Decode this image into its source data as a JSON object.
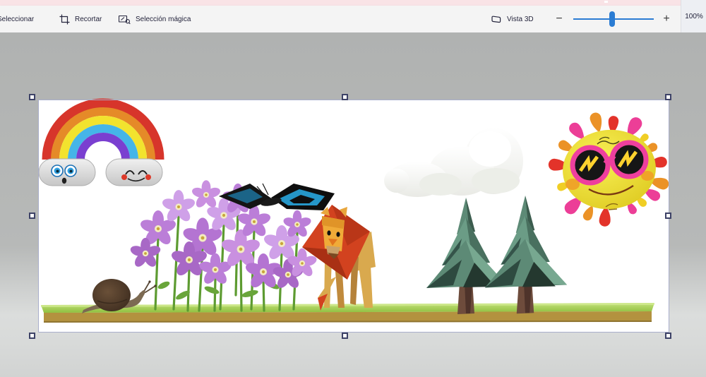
{
  "colors": {
    "accent_strip_pink": "#f9e3e6",
    "slider_blue": "#2b7cd3",
    "toolbar_bg": "#f4f4f4",
    "workspace_gray": "#b2b4b3"
  },
  "toolbar": {
    "select_label": "Seleccionar",
    "crop_label": "Recortar",
    "magic_select_label": "Selección mágica",
    "view3d_label": "Vista 3D",
    "zoom_out_glyph": "−",
    "zoom_in_glyph": "+",
    "zoom_value": "100%"
  },
  "canvas": {
    "selected": true,
    "objects": [
      "rainbow-with-cloud-faces",
      "purple-flowers",
      "butterfly",
      "snail",
      "low-poly-lion",
      "white-cloud",
      "pine-tree",
      "pine-tree",
      "sun-with-sunglasses",
      "grass-platform"
    ]
  }
}
